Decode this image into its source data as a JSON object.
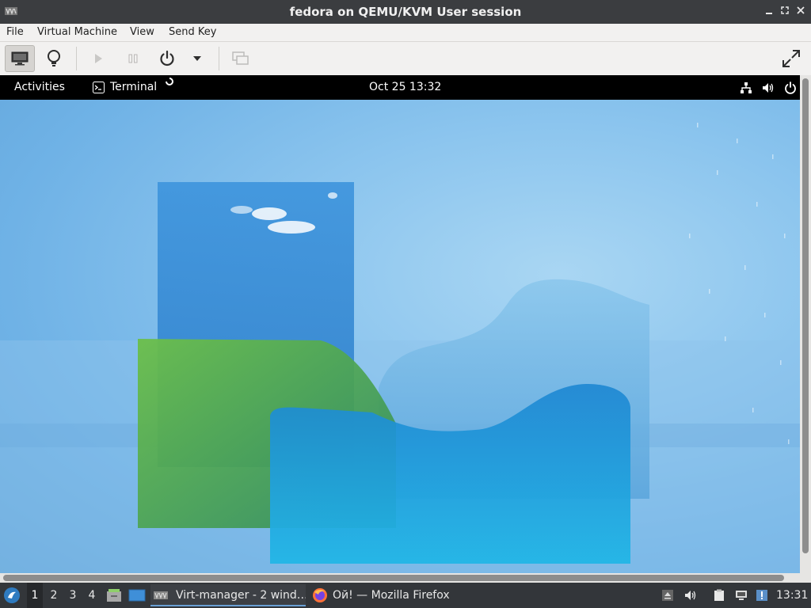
{
  "window": {
    "title": "fedora on QEMU/KVM User session",
    "controls": [
      "minimize",
      "restore",
      "close"
    ]
  },
  "menubar": {
    "items": [
      "File",
      "Virtual Machine",
      "View",
      "Send Key"
    ]
  },
  "toolbar": {
    "buttons": [
      {
        "name": "console-view",
        "icon": "monitor-icon",
        "active": true
      },
      {
        "name": "details-view",
        "icon": "lightbulb-icon"
      },
      {
        "name": "run",
        "icon": "play-icon",
        "enabled": false
      },
      {
        "name": "pause",
        "icon": "pause-icon",
        "enabled": false
      },
      {
        "name": "shutdown",
        "icon": "power-icon"
      },
      {
        "name": "shutdown-menu",
        "icon": "chevron-down-icon"
      },
      {
        "name": "snapshots",
        "icon": "snapshot-icon",
        "enabled": false
      },
      {
        "name": "fullscreen",
        "icon": "fullscreen-icon"
      }
    ]
  },
  "guest": {
    "topbar": {
      "activities": "Activities",
      "app_name": "Terminal",
      "datetime": "Oct 25  13:32",
      "icons": [
        "network-icon",
        "volume-icon",
        "power-icon"
      ]
    },
    "wallpaper_colors": {
      "sky": "#8cc5ee",
      "green": "#5aa84a",
      "blue": "#1f9bdc"
    }
  },
  "taskbar": {
    "workspaces": [
      "1",
      "2",
      "3",
      "4"
    ],
    "active_workspace": "1",
    "tasks": [
      {
        "label": "Virt-manager - 2 wind…",
        "icon": "virt-manager-icon",
        "active": true
      },
      {
        "label": "Ой! — Mozilla Firefox",
        "icon": "firefox-icon",
        "active": false
      }
    ],
    "clock": "13:31",
    "tray_icons": [
      "eject-icon",
      "volume-icon",
      "clipboard-icon",
      "network-icon",
      "notification-icon"
    ]
  }
}
